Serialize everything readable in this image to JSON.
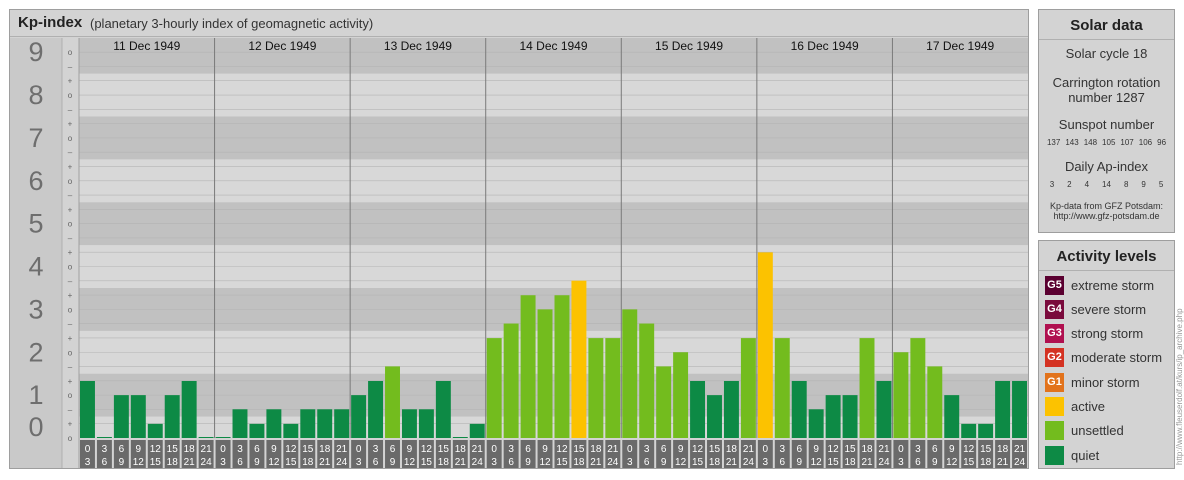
{
  "header": {
    "title": "Kp-index",
    "subtitle": "(planetary 3-hourly index of geomagnetic activity)"
  },
  "chart_data": {
    "type": "bar",
    "y_labels": [
      "0",
      "1",
      "2",
      "3",
      "4",
      "5",
      "6",
      "7",
      "8",
      "9"
    ],
    "sub_labels": [
      "–",
      "o",
      "+"
    ],
    "ylim": [
      0,
      9.33
    ],
    "days": [
      "11 Dec 1949",
      "12 Dec 1949",
      "13 Dec 1949",
      "14 Dec 1949",
      "15 Dec 1949",
      "16 Dec 1949",
      "17 Dec 1949"
    ],
    "hour_starts": [
      "0",
      "3",
      "6",
      "9",
      "12",
      "15",
      "18",
      "21"
    ],
    "hour_ends": [
      "3",
      "6",
      "9",
      "12",
      "15",
      "18",
      "21",
      "24"
    ],
    "values": [
      [
        1.33,
        0,
        1.0,
        1.0,
        0.33,
        1.0,
        1.33,
        0
      ],
      [
        0,
        0.67,
        0.33,
        0.67,
        0.33,
        0.67,
        0.67,
        0.67
      ],
      [
        1.0,
        1.33,
        1.67,
        0.67,
        0.67,
        1.33,
        0,
        0.33
      ],
      [
        2.33,
        2.67,
        3.33,
        3.0,
        3.33,
        3.67,
        2.33,
        2.33
      ],
      [
        3.0,
        2.67,
        1.67,
        2.0,
        1.33,
        1.0,
        1.33,
        2.33
      ],
      [
        4.33,
        2.33,
        1.33,
        0.67,
        1.0,
        1.0,
        2.33,
        1.33
      ],
      [
        2.0,
        2.33,
        1.67,
        1.0,
        0.33,
        0.33,
        1.33,
        1.33
      ]
    ],
    "colors": {
      "quiet": "#0d8a45",
      "unsettled": "#73bc1e",
      "active": "#fcc200"
    }
  },
  "solar_data": {
    "title": "Solar data",
    "cycle": "Solar cycle 18",
    "carrington_line1": "Carrington rotation",
    "carrington_line2": "number 1287",
    "sunspot_label": "Sunspot number",
    "sunspot_values": [
      "137",
      "143",
      "148",
      "105",
      "107",
      "106",
      "96"
    ],
    "ap_label": "Daily Ap-index",
    "ap_values": [
      "3",
      "2",
      "4",
      "14",
      "8",
      "9",
      "5"
    ],
    "source_line1": "Kp-data from GFZ Potsdam:",
    "source_line2": "http://www.gfz-potsdam.de"
  },
  "activity_levels": {
    "title": "Activity levels",
    "items": [
      {
        "code": "G5",
        "label": "extreme storm",
        "color": "#5a0030"
      },
      {
        "code": "G4",
        "label": "severe storm",
        "color": "#7a0a3c"
      },
      {
        "code": "G3",
        "label": "strong storm",
        "color": "#b0104f"
      },
      {
        "code": "G2",
        "label": "moderate storm",
        "color": "#d43222"
      },
      {
        "code": "G1",
        "label": "minor storm",
        "color": "#e2731c"
      },
      {
        "code": "",
        "label": "active",
        "color": "#fcc200"
      },
      {
        "code": "",
        "label": "unsettled",
        "color": "#73bc1e"
      },
      {
        "code": "",
        "label": "quiet",
        "color": "#0d8a45"
      }
    ]
  },
  "watermark": "http://www.fleuserdolf.at/kurs/ip_archive.php"
}
